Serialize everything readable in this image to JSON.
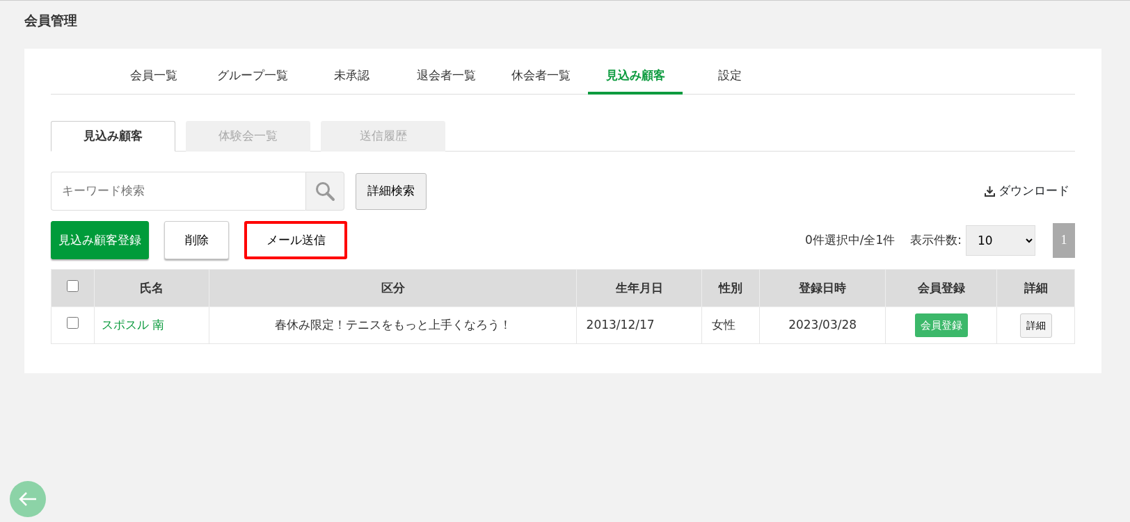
{
  "page_title": "会員管理",
  "tabs": [
    {
      "label": "会員一覧",
      "selected": false
    },
    {
      "label": "グループ一覧",
      "selected": false
    },
    {
      "label": "未承認",
      "selected": false
    },
    {
      "label": "退会者一覧",
      "selected": false
    },
    {
      "label": "休会者一覧",
      "selected": false
    },
    {
      "label": "見込み顧客",
      "selected": true
    },
    {
      "label": "設定",
      "selected": false
    }
  ],
  "sub_tabs": [
    {
      "label": "見込み顧客",
      "selected": true
    },
    {
      "label": "体験会一覧",
      "selected": false
    },
    {
      "label": "送信履歴",
      "selected": false
    }
  ],
  "search": {
    "placeholder": "キーワード検索"
  },
  "advanced_search": "詳細検索",
  "download": "ダウンロード",
  "actions": [
    {
      "label": "見込み顧客登録",
      "kind": "primary",
      "highlighted": false
    },
    {
      "label": "削除",
      "kind": "default",
      "highlighted": false
    },
    {
      "label": "メール送信",
      "kind": "default",
      "highlighted": true
    }
  ],
  "selection_count": "0件選択中/全1件",
  "page_size": {
    "label": "表示件数:",
    "value": "10"
  },
  "pages": [
    {
      "label": "1",
      "selected": true
    }
  ],
  "table": {
    "select_all_checked": false,
    "columns": [
      "氏名",
      "区分",
      "生年月日",
      "性別",
      "登録日時",
      "会員登録",
      "詳細"
    ],
    "rows": [
      {
        "checked": false,
        "name": "スポスル 南",
        "category": "春休み限定！テニスをもっと上手くなろう！",
        "birthday": "2013/12/17",
        "gender": "女性",
        "registered": "2023/03/28",
        "register_button": "会員登録",
        "detail_button": "詳細"
      }
    ]
  }
}
